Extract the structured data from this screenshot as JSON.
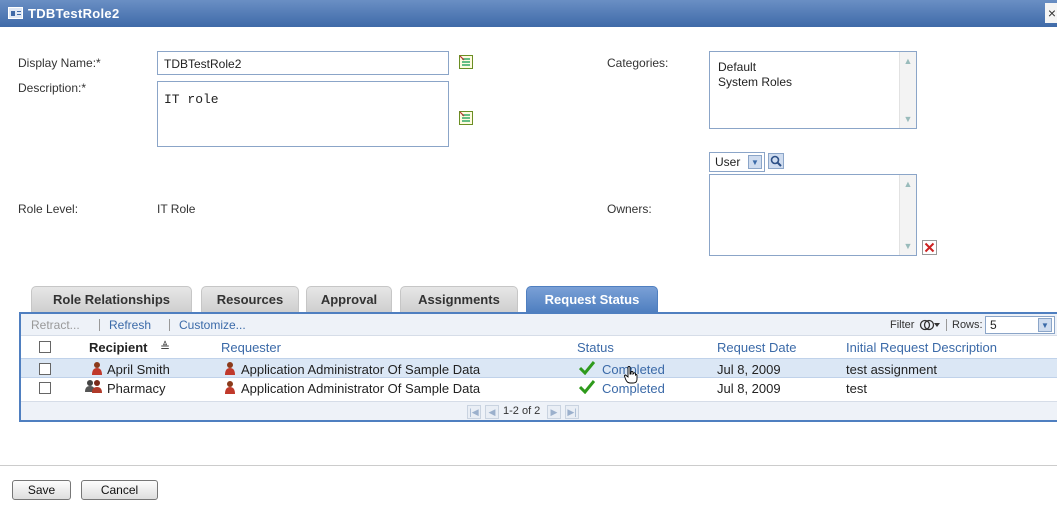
{
  "window": {
    "title": "TDBTestRole2",
    "close_glyph": "×"
  },
  "form": {
    "display_name_label": "Display Name:*",
    "display_name_value": "TDBTestRole2",
    "description_label": "Description:*",
    "description_value": "IT role",
    "role_level_label": "Role Level:",
    "role_level_value": "IT Role",
    "categories_label": "Categories:",
    "categories": [
      "Default",
      "System Roles"
    ],
    "owners_label": "Owners:",
    "owner_type_selected": "User"
  },
  "tabs": [
    {
      "label": "Role Relationships",
      "active": false
    },
    {
      "label": "Resources",
      "active": false
    },
    {
      "label": "Approval",
      "active": false
    },
    {
      "label": "Assignments",
      "active": false
    },
    {
      "label": "Request Status",
      "active": true
    }
  ],
  "toolbar": {
    "retract": "Retract...",
    "refresh": "Refresh",
    "customize": "Customize...",
    "filter_label": "Filter",
    "rows_label": "Rows:",
    "rows_value": "5"
  },
  "table": {
    "columns": [
      "Recipient",
      "Requester",
      "Status",
      "Request Date",
      "Initial Request Description"
    ],
    "sort_indicator": "≜",
    "rows": [
      {
        "recipient": "April Smith",
        "requester": "Application Administrator Of Sample Data",
        "status": "Completed",
        "date": "Jul 8, 2009",
        "description": "test assignment",
        "selected": true
      },
      {
        "recipient": "Pharmacy",
        "requester": "Application Administrator Of Sample Data",
        "status": "Completed",
        "date": "Jul 8, 2009",
        "description": "test",
        "selected": false
      }
    ],
    "pagination": "1-2 of 2"
  },
  "buttons": {
    "save": "Save",
    "cancel": "Cancel"
  },
  "colors": {
    "accent": "#4f7fc0",
    "link": "#3b6aa8",
    "check": "#2e9a1c",
    "remove": "#cc2222"
  }
}
